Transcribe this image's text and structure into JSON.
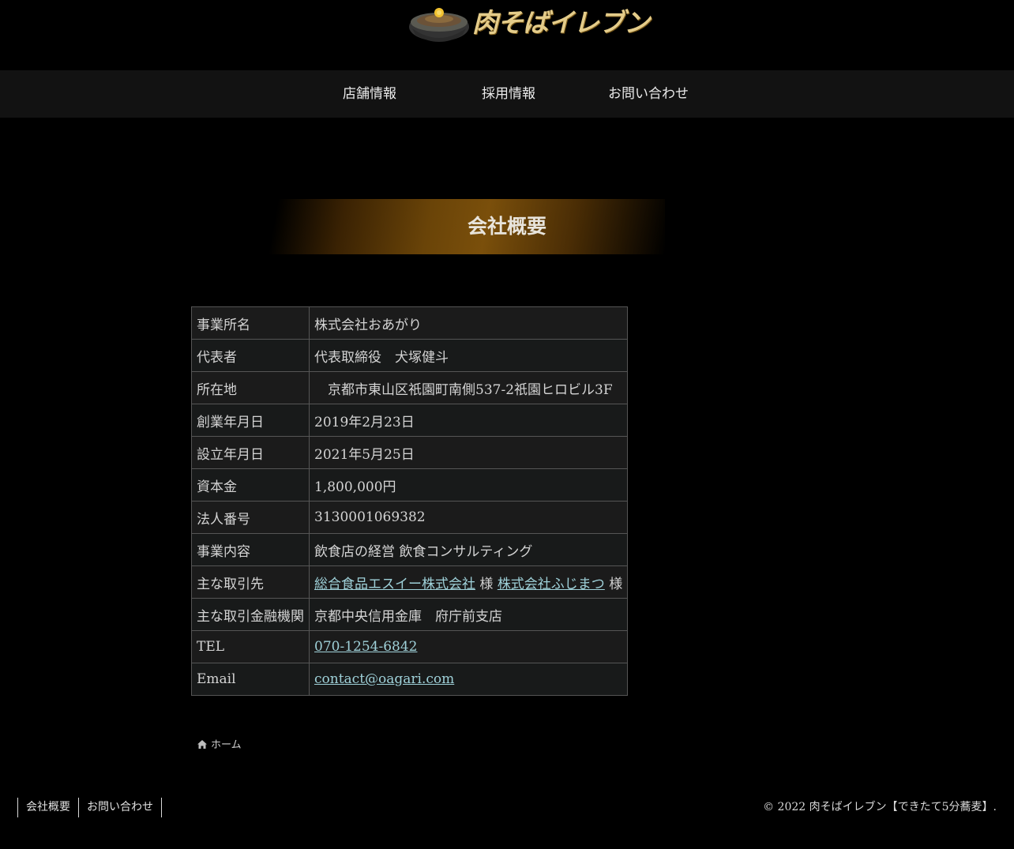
{
  "header": {
    "logo_text": "肉そばイレブン"
  },
  "nav": {
    "items": [
      {
        "label": "店舗情報"
      },
      {
        "label": "採用情報"
      },
      {
        "label": "お問い合わせ"
      }
    ]
  },
  "main": {
    "title": "会社概要",
    "rows": [
      {
        "key": "事業所名",
        "value": "株式会社おあがり"
      },
      {
        "key": "代表者",
        "value": "代表取締役　犬塚健斗"
      },
      {
        "key": "所在地",
        "value": "　京都市東山区祇園町南側537-2祇園ヒロビル3F"
      },
      {
        "key": "創業年月日",
        "value": "2019年2月23日"
      },
      {
        "key": "設立年月日",
        "value": "2021年5月25日"
      },
      {
        "key": "資本金",
        "value": "1,800,000円"
      },
      {
        "key": "法人番号",
        "value": "3130001069382"
      },
      {
        "key": "事業内容",
        "value": "飲食店の経営 飲食コンサルティング"
      },
      {
        "key": "主な取引先",
        "link1": "総合食品エスイー株式会社",
        "suffix1": " 様 ",
        "link2": "株式会社ふじまつ",
        "suffix2": " 様"
      },
      {
        "key": "主な取引金融機関",
        "value": "京都中央信用金庫　府庁前支店"
      },
      {
        "key": "TEL",
        "link": "070-1254-6842"
      },
      {
        "key": "Email",
        "link": "contact@oagari.com"
      }
    ]
  },
  "breadcrumb": {
    "home_label": "ホーム"
  },
  "footer": {
    "links": [
      {
        "label": "会社概要"
      },
      {
        "label": "お問い合わせ"
      }
    ],
    "copyright": "© 2022 肉そばイレブン【できたて5分蕎麦】."
  },
  "colors": {
    "background": "#000000",
    "nav_background": "#121212",
    "link": "#9fd1d9",
    "gold": "#e4cc8a"
  }
}
